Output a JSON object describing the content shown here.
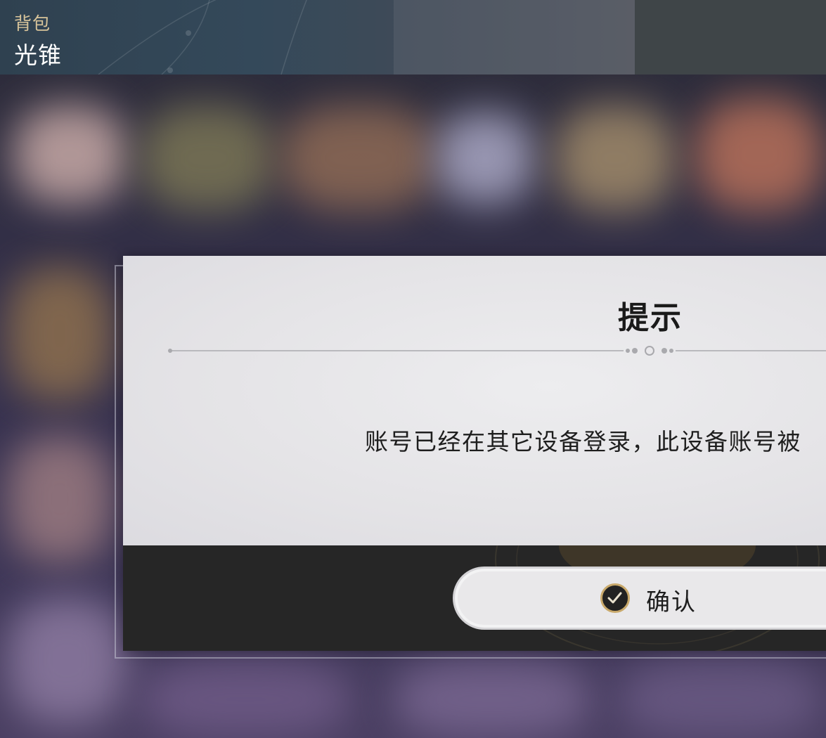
{
  "header": {
    "breadcrumb": "背包",
    "title": "光锥"
  },
  "dialog": {
    "title": "提示",
    "message": "账号已经在其它设备登录，此设备账号被",
    "confirm_label": "确认"
  },
  "colors": {
    "breadcrumb_gold": "#d8c49a",
    "dialog_bg": "#e9e8ea",
    "footer_bg": "#262626",
    "confirm_icon_ring": "#c8a86a"
  }
}
